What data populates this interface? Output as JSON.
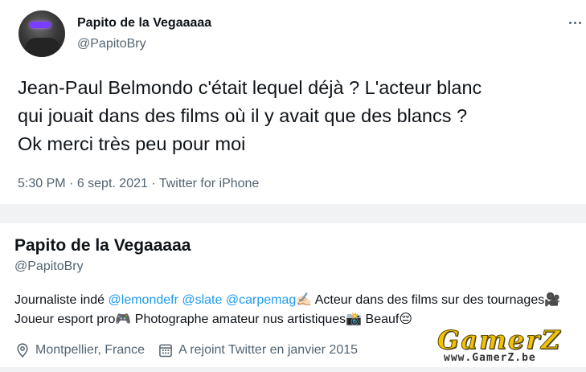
{
  "tweet": {
    "author_name": "Papito de la Vegaaaaa",
    "author_handle": "@PapitoBry",
    "text": "Jean-Paul Belmondo c'était lequel déjà ? L'acteur blanc\nqui jouait dans des films où il y avait que des blancs ?\nOk merci très peu pour moi",
    "time": "5:30 PM",
    "separator": " · ",
    "date": "6 sept. 2021",
    "source": "Twitter for iPhone",
    "more_icon": "more-horizontal-icon"
  },
  "profile": {
    "name": "Papito de la Vegaaaaa",
    "handle": "@PapitoBry",
    "bio": {
      "prefix": "Journaliste indé ",
      "mention1": "@lemondefr",
      "space1": " ",
      "mention2": "@slate",
      "space2": " ",
      "mention3": "@carpemag",
      "emoji1": "✍🏻",
      "part2": " Acteur dans des films sur des tournages",
      "emoji2": "🎥",
      "part3": " Joueur esport pro",
      "emoji3": "🎮",
      "part4": " Photographe amateur nus artistiques",
      "emoji4": "📸",
      "part5": " Beauf",
      "emoji5": "😔"
    },
    "location": "Montpellier, France",
    "joined": "A rejoint Twitter en janvier 2015",
    "location_icon": "location-pin-icon",
    "calendar_icon": "calendar-icon"
  },
  "watermark": {
    "main": "GamerZ",
    "sub": "www.GamerZ.be"
  },
  "colors": {
    "text": "#0f1419",
    "secondary": "#536471",
    "link": "#1d9bf0",
    "divider": "#f0f2f3",
    "watermark": "#f2c300"
  }
}
